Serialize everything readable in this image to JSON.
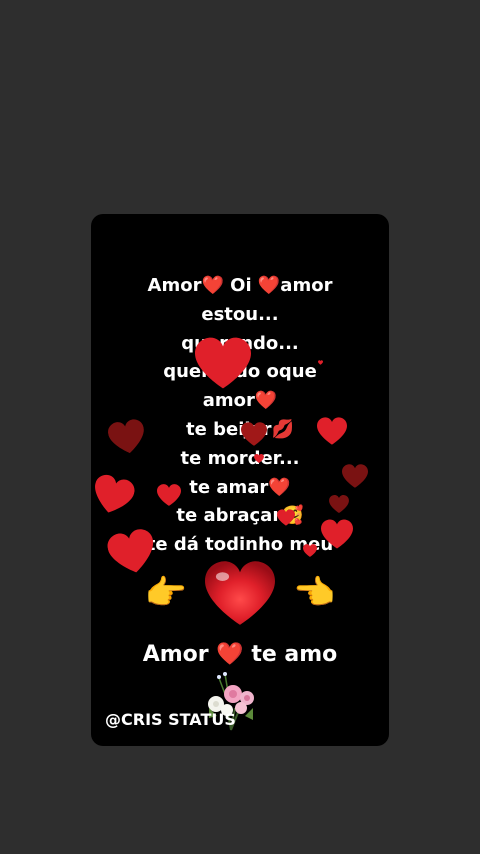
{
  "status": {
    "lines": [
      "Amor❤️  Oi ❤️amor",
      "estou...",
      "querendo...",
      "querendo oque",
      "amor❤️",
      "te beijar💋",
      "te morder...",
      "te amar❤️",
      "te abraçar🥰",
      "te dá todinho meu"
    ],
    "footer": "Amor ❤️ te amo",
    "watermark": "@CRIS STATUS"
  },
  "icons": {
    "left_hand": "👉",
    "right_hand": "👈",
    "big_heart": "heart-icon",
    "flowers": "bouquet-icon"
  },
  "colors": {
    "background": "#2e2e2e",
    "card": "#000000",
    "heart_red": "#e0202a",
    "heart_dark": "#7a1212"
  }
}
